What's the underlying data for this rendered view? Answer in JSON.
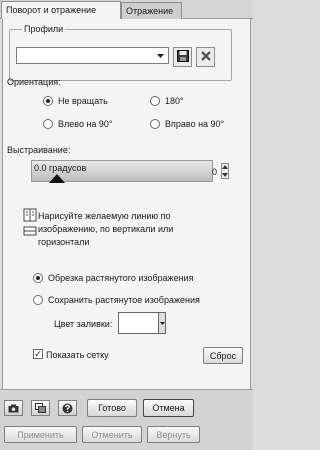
{
  "tabs": [
    {
      "label": "Поворот и отражение"
    },
    {
      "label": "Отражение"
    }
  ],
  "profiles": {
    "legend": "Профили",
    "value": ""
  },
  "orientation": {
    "label": "Ориентация:",
    "options": [
      {
        "label": "Не вращать",
        "selected": true
      },
      {
        "label": "180°",
        "selected": false
      },
      {
        "label": "Влево на 90°",
        "selected": false
      },
      {
        "label": "Вправо на 90°",
        "selected": false
      }
    ]
  },
  "straighten": {
    "label": "Выстраивание:",
    "slider_text": "0.0 градусов",
    "value": "0"
  },
  "hint": {
    "line1": "Нарисуйте желаемую линию по",
    "line2": "изображению, по вертикали или",
    "line3": "горизонтали"
  },
  "crop_mode": {
    "options": [
      {
        "label": "Обрезка растянутого изображения",
        "selected": true
      },
      {
        "label": "Сохранить растянутое изображения",
        "selected": false
      }
    ],
    "fill_label": "Цвет заливки:",
    "fill_color": "#ffffff"
  },
  "grid": {
    "label": "Показать сетку",
    "checked": true,
    "check_mark": "✓",
    "reset_label": "Сброс"
  },
  "footer": {
    "ok_label": "Готово",
    "cancel_label": "Отмена",
    "apply_label": "Применить",
    "undo_label": "Отменить",
    "redo_label": "Вернуть"
  }
}
